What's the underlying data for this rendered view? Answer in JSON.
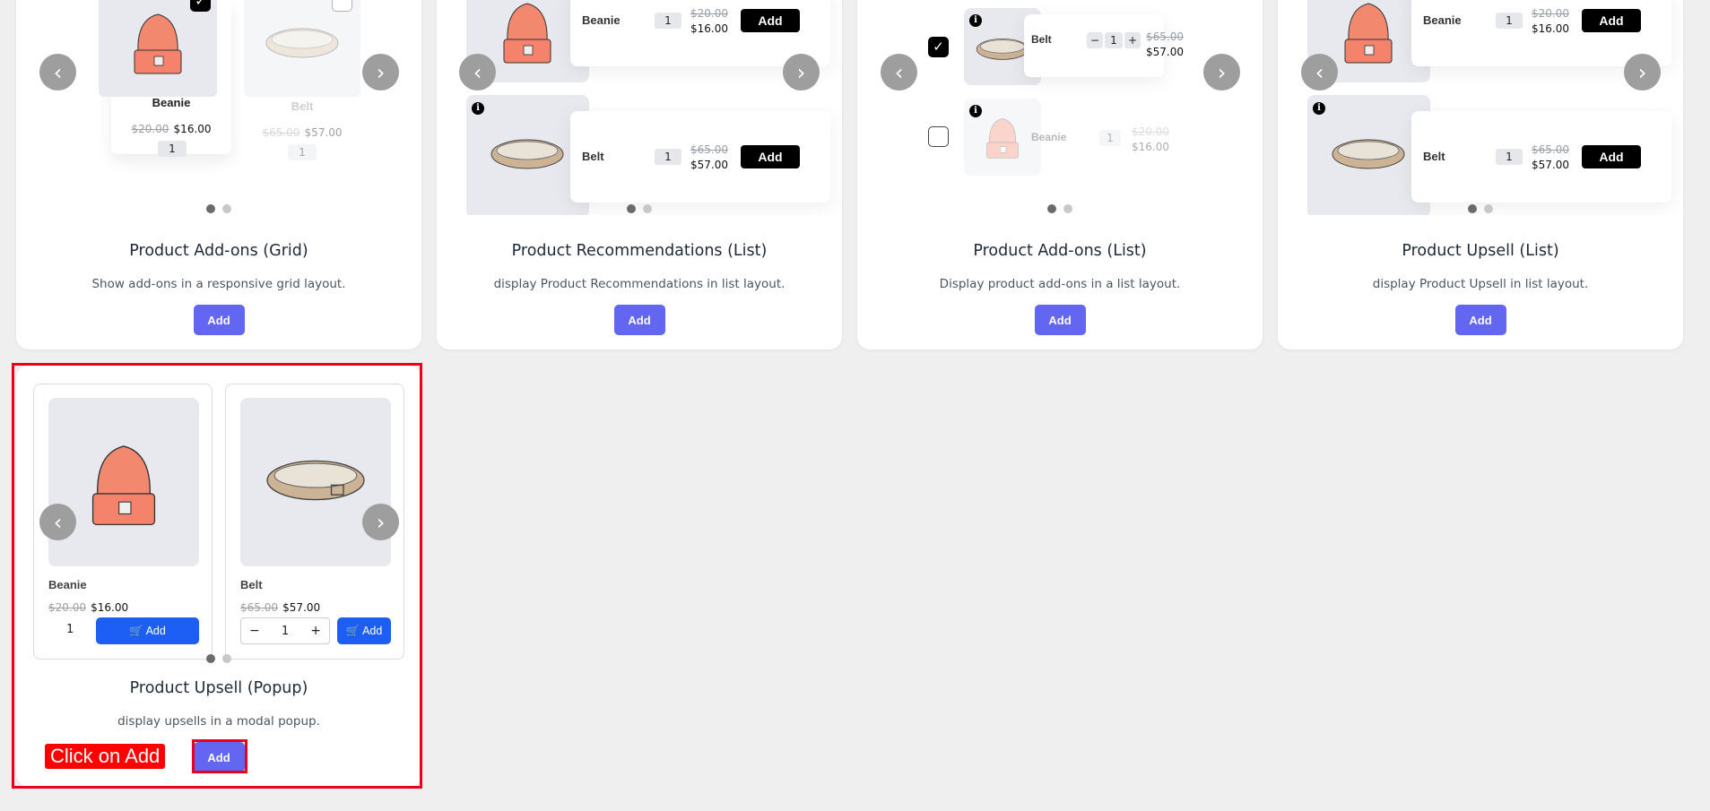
{
  "cards": [
    {
      "title": "Product Add-ons (Grid)",
      "desc": "Show add-ons in a responsive grid layout.",
      "add_label": "Add"
    },
    {
      "title": "Product Recommendations (List)",
      "desc": "display Product Recommendations in list layout.",
      "add_label": "Add"
    },
    {
      "title": "Product Add-ons (List)",
      "desc": "Display product add-ons in a list layout.",
      "add_label": "Add"
    },
    {
      "title": "Product Upsell (List)",
      "desc": "display Product Upsell in list layout.",
      "add_label": "Add"
    },
    {
      "title": "Product Upsell (Popup)",
      "desc": "display upsells in a modal popup.",
      "add_label": "Add"
    }
  ],
  "products": [
    {
      "name": "Beanie",
      "old_price": "$20.00",
      "price": "$16.00",
      "qty": "1"
    },
    {
      "name": "Belt",
      "old_price": "$65.00",
      "price": "$57.00",
      "qty": "1"
    }
  ],
  "popup": {
    "add_label": "Add",
    "minus": "−",
    "plus": "+"
  },
  "list_add_label": "Add",
  "nav": {
    "prev": "‹",
    "next": "›"
  },
  "check_mark": "✓",
  "info_glyph": "i",
  "annotation": {
    "callout": "Click on Add"
  },
  "colors": {
    "accent": "#6366f1",
    "cart_blue": "#1d5ff5",
    "highlight": "#e8001c"
  }
}
